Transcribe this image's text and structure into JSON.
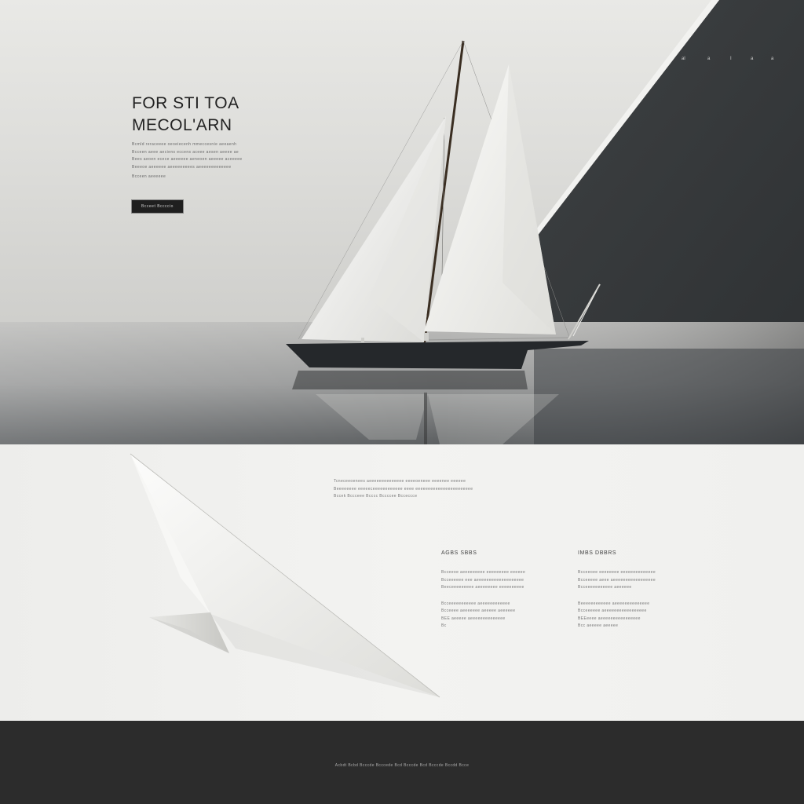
{
  "hero": {
    "title_line1": "FOR STI TOA",
    "title_line2": "MECOL'ARN",
    "body_lines": [
      "Bcmld reraceeee oeoeiecenh mmeccesnie aeeaenh",
      "Bcceen aeee aeciens eccens aceee aesen aeeee ae",
      "Bees aeoen ecece aeeeeee aeneoen aeeeee aceeeee",
      "Beeeoe aeeeeee aeeeeeeeees aeeeeeeeeeeeee",
      "Bcceen aeeeeee"
    ],
    "cta_label": "Bcceet Bccccio"
  },
  "topnav": {
    "items": [
      "al",
      "a",
      "I",
      "a",
      "a"
    ],
    "item_icons": [
      "nav-mark-icon",
      "triangle-icon",
      "bar-icon",
      "square-icon",
      "bookmark-icon"
    ]
  },
  "feature": {
    "intro_lines": [
      "Tcneceeoenees aeeeeeeeeeeeeee eeeeoeneee eeeenee eeeeee",
      "Beeeeeeee eeeeeceeeeeeeeeeee eeee eeeeeeeeeeeeeeeeeeeeeee",
      "Bccek Bccceee Bcccc Bccccee Bcceccce"
    ],
    "columns": [
      {
        "title": "AGBS SBBS",
        "para1": [
          "Bcceeoe aeeeeeeeee eeeeeeeee eeeeee",
          "Bcceeeeee eee aeeeeeeeeeeeeeeeeeee",
          "Beeceeeeeeeee aeeeeeeee eeeeeeeeee"
        ],
        "para2": [
          "Bcceeeeeeeeeee aeeeeeeeeeeee",
          "Bcceeee aeeeeeee aeeeee aeeeeee",
          "BEE aeeeee aeeeeeeeeeeeeee",
          "Bc"
        ]
      },
      {
        "title": "IMBS DBBRS",
        "para1": [
          "Bcceeoee eeeeeeee eeeeeeeeeeeeee",
          "Bcceeeee aeee aeeeeeeeeeeeeeeeee",
          "Bcceeeeeeeeeee aeeeeee"
        ],
        "para2": [
          "Beeeeeeeeeeee aeeeeeeeeeeeeee",
          "Bcceeeeee aeeeeeeeeeeeeeeeee",
          "BEEeeee aeeeeeeeeeeeeeeee",
          "Bcc aeeeee aeeeee"
        ]
      }
    ]
  },
  "footer": {
    "text": "Acbdt Bcbd Bcccde Bcccede Bcd Bcccde Bcd Bcccde Bccdd Bcce"
  },
  "colors": {
    "hero_panel": "#3a3d3f",
    "hull": "#25282b",
    "sail": "#f1f1ee",
    "footer_bg": "#2c2c2c",
    "cta_bg": "#1f1f1f"
  }
}
